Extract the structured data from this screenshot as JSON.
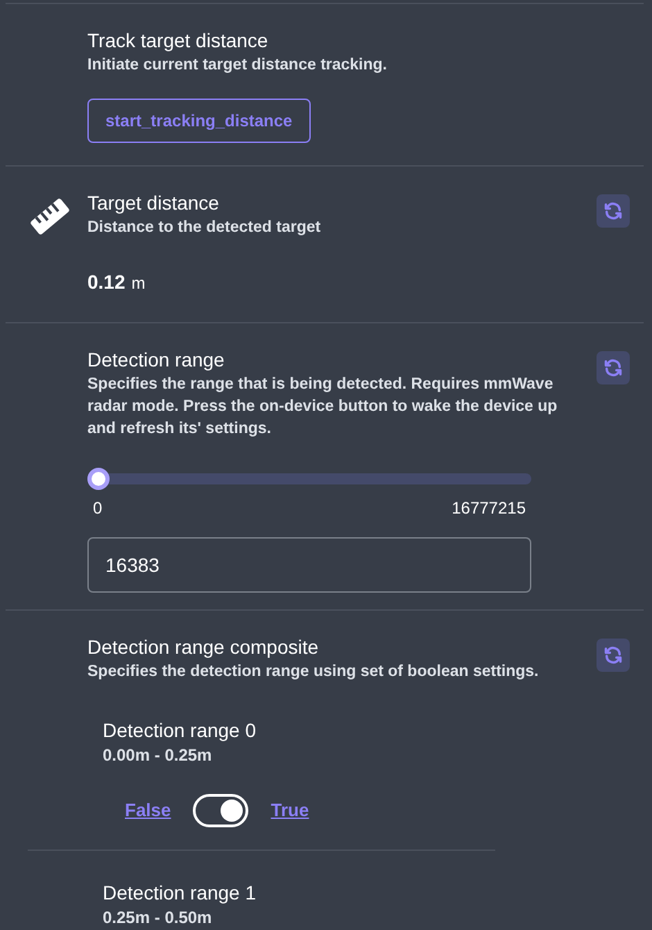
{
  "sections": [
    {
      "kind": "action",
      "title": "Track target distance",
      "description": "Initiate current target distance tracking.",
      "button": "start_tracking_distance"
    },
    {
      "kind": "value",
      "title": "Target distance",
      "description": "Distance to the detected target",
      "value": "0.12",
      "unit": "m"
    },
    {
      "kind": "range",
      "title": "Detection range",
      "description": "Specifies the range that is being detected. Requires mmWave radar mode. Press the on-device button to wake the device up and refresh its' settings.",
      "level": 0,
      "min": "0",
      "max": "16777215",
      "input": "16383"
    },
    {
      "kind": "composite",
      "title": "Detection range composite",
      "description": "Specifies the detection range using set of boolean settings.",
      "items": [
        {
          "title": "Detection range 0",
          "description": "0.00m - 0.25m",
          "false_label": "False",
          "true_label": "True",
          "on": true
        },
        {
          "title": "Detection range 1",
          "description": "0.25m - 0.50m"
        }
      ]
    }
  ]
}
